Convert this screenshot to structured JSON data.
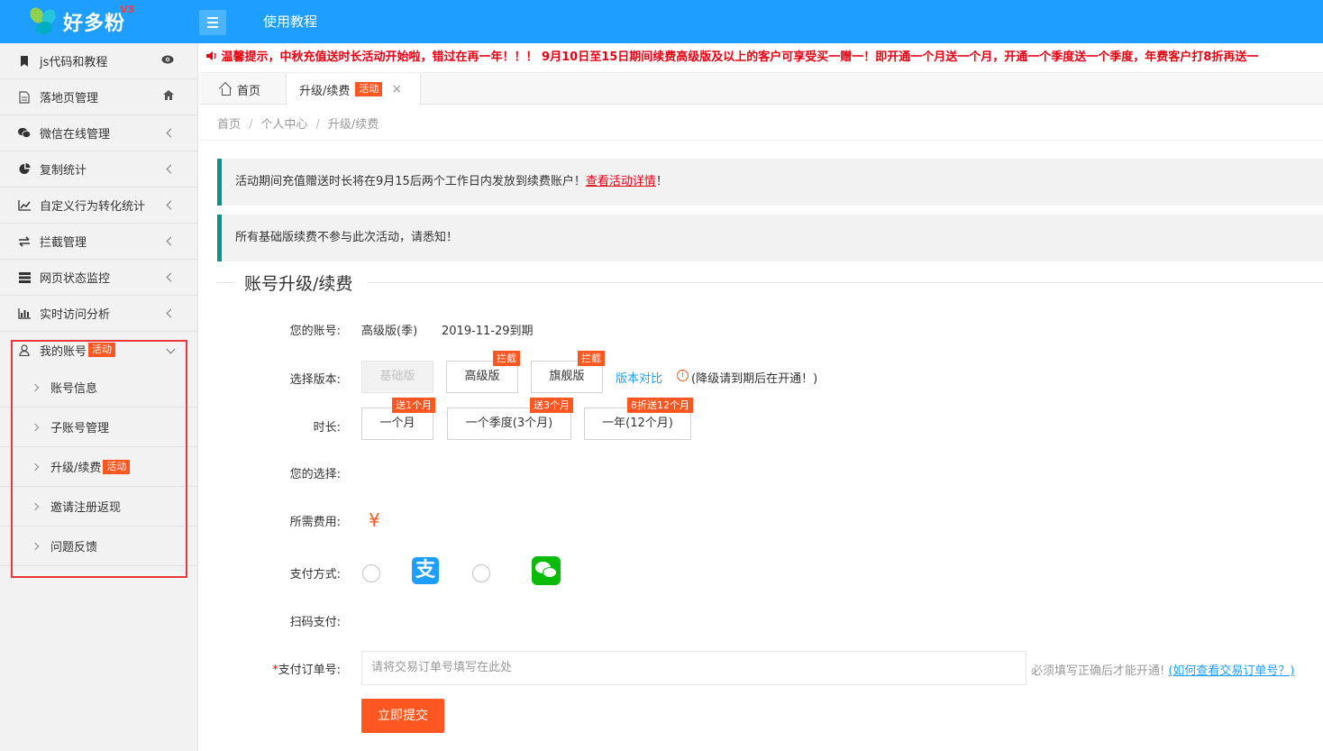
{
  "app": {
    "logo_text": "好多粉",
    "logo_version": "V3",
    "top_link": "使用教程",
    "accent_color": "#1e9fff",
    "badge_color": "#ff5722"
  },
  "notice": {
    "icon": "speaker-icon",
    "text": "温馨提示，中秋充值送时长活动开始啦，错过在再一年！！！ 9月10日至15日期间续费高级版及以上的客户可享受买一赠一！即开通一个月送一个月，开通一个季度送一个季度，年费客户打8折再送一"
  },
  "sidebar": {
    "items": [
      {
        "label": "js代码和教程",
        "icon": "bookmark-icon",
        "right": "eye-icon"
      },
      {
        "label": "落地页管理",
        "icon": "file-icon",
        "right": "home-icon"
      },
      {
        "label": "微信在线管理",
        "icon": "wechat-icon",
        "right": "chevron-left-icon"
      },
      {
        "label": "复制统计",
        "icon": "pie-chart-icon",
        "right": "chevron-left-icon"
      },
      {
        "label": "自定义行为转化统计",
        "icon": "line-chart-icon",
        "right": "chevron-left-icon"
      },
      {
        "label": "拦截管理",
        "icon": "exchange-icon",
        "right": "chevron-left-icon"
      },
      {
        "label": "网页状态监控",
        "icon": "server-icon",
        "right": "chevron-left-icon"
      },
      {
        "label": "实时访问分析",
        "icon": "bar-chart-icon",
        "right": "chevron-left-icon"
      }
    ],
    "account": {
      "label": "我的账号",
      "badge": "活动",
      "icon": "user-icon",
      "sub_items": [
        {
          "label": "账号信息",
          "badge": ""
        },
        {
          "label": "子账号管理",
          "badge": ""
        },
        {
          "label": "升级/续费",
          "badge": "活动"
        },
        {
          "label": "邀请注册返现",
          "badge": ""
        },
        {
          "label": "问题反馈",
          "badge": ""
        }
      ]
    }
  },
  "tabs": {
    "home": "首页",
    "current": "升级/续费",
    "current_badge": "活动",
    "close": "×"
  },
  "breadcrumb": {
    "items": [
      "首页",
      "个人中心",
      "升级/续费"
    ],
    "separator": "/"
  },
  "tips": {
    "tip1_text": "活动期间充值赠送时长将在9月15后两个工作日内发放到续费账户！",
    "tip1_link": "查看活动详情",
    "tip1_suffix": "！",
    "tip2_text": "所有基础版续费不参与此次活动，请悉知！"
  },
  "form": {
    "title": "账号升级/续费",
    "account_label": "您的账号:",
    "account_version": "高级版(季)",
    "account_expiry": "2019-11-29到期",
    "version_label": "选择版本:",
    "versions": [
      {
        "label": "基础版",
        "corner": "",
        "disabled": true
      },
      {
        "label": "高级版",
        "corner": "拦截",
        "disabled": false
      },
      {
        "label": "旗舰版",
        "corner": "拦截",
        "disabled": false
      }
    ],
    "compare_link": "版本对比",
    "downgrade_note": "(降级请到期后在开通！)",
    "duration_label": "时长:",
    "durations": [
      {
        "label": "一个月",
        "corner": "送1个月"
      },
      {
        "label": "一个季度(3个月)",
        "corner": "送3个月"
      },
      {
        "label": "一年(12个月)",
        "corner": "8折送12个月"
      }
    ],
    "choice_label": "您的选择:",
    "fee_label": "所需费用:",
    "fee_symbol": "¥",
    "pay_label": "支付方式:",
    "pay_methods": [
      "alipay-icon",
      "wechat-pay-icon"
    ],
    "qr_label": "扫码支付:",
    "order_required": "*",
    "order_label": "支付订单号:",
    "order_placeholder": "请将交易订单号填写在此处",
    "order_hint": "必须填写正确后才能开通!",
    "order_hint_link": "(如何查看交易订单号？)",
    "submit": "立即提交"
  }
}
